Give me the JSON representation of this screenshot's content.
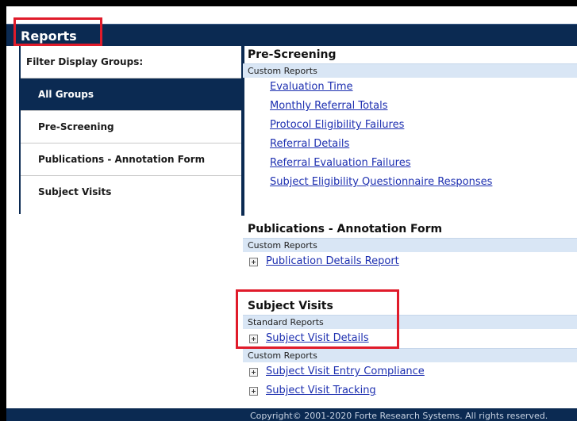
{
  "header": {
    "title": "Reports"
  },
  "sidebar": {
    "heading": "Filter Display Groups:",
    "items": [
      {
        "label": "All Groups",
        "active": true
      },
      {
        "label": "Pre-Screening",
        "active": false
      },
      {
        "label": "Publications - Annotation Form",
        "active": false
      },
      {
        "label": "Subject Visits",
        "active": false
      }
    ]
  },
  "sections": {
    "prescreening": {
      "title": "Pre-Screening",
      "custom_label": "Custom Reports",
      "links": [
        "Evaluation Time",
        "Monthly Referral Totals",
        "Protocol Eligibility Failures",
        "Referral Details",
        "Referral Evaluation Failures",
        "Subject Eligibility Questionnaire Responses"
      ]
    },
    "publications": {
      "title": "Publications - Annotation Form",
      "custom_label": "Custom Reports",
      "links": [
        "Publication Details Report"
      ]
    },
    "subject_visits": {
      "title": "Subject Visits",
      "standard_label": "Standard Reports",
      "standard_links": [
        "Subject Visit Details"
      ],
      "custom_label": "Custom Reports",
      "custom_links": [
        "Subject Visit Entry Compliance",
        "Subject Visit Tracking"
      ]
    }
  },
  "footer": {
    "text": "Copyright© 2001-2020 Forte Research Systems. All rights reserved."
  },
  "colors": {
    "navy": "#0b2a52",
    "link": "#1d2fb0",
    "highlight_box": "#e01b2a",
    "subheader_bg": "#d9e6f5"
  }
}
